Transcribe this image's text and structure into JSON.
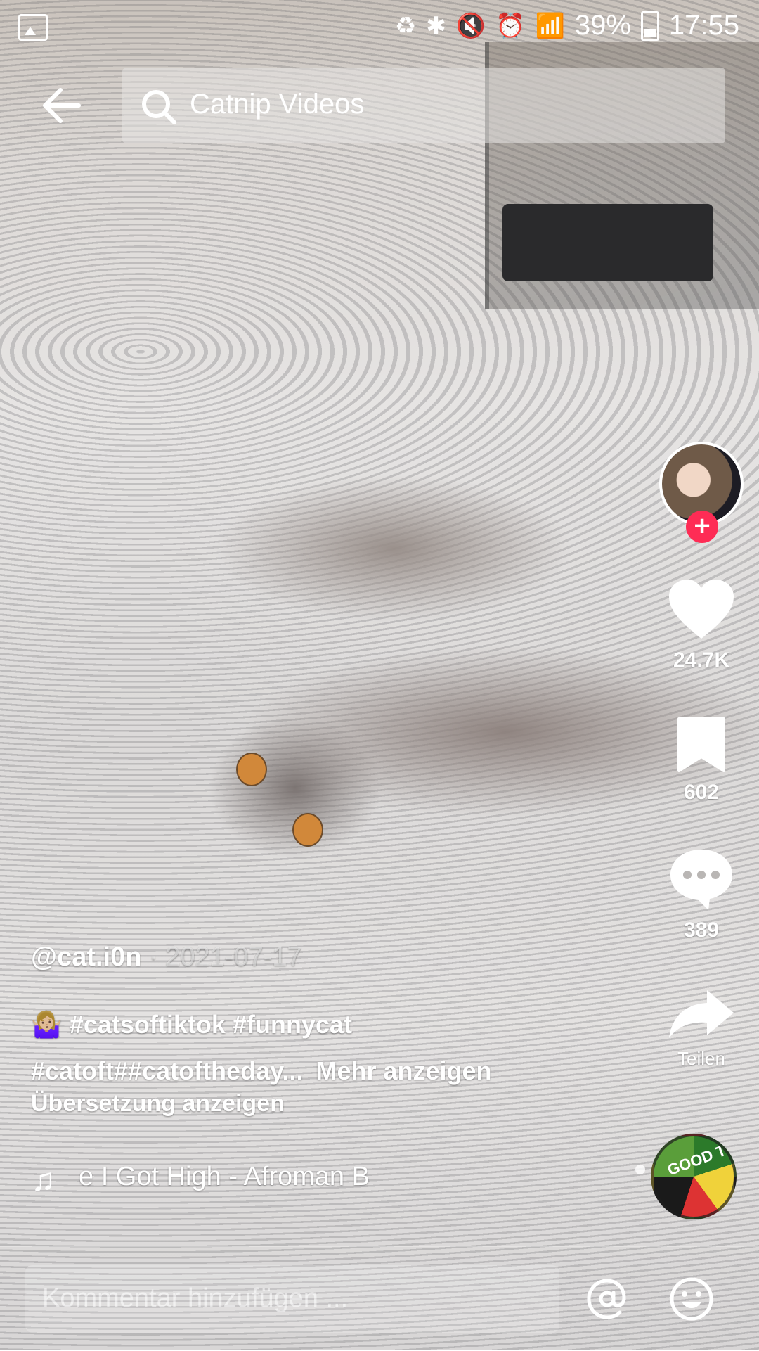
{
  "status_bar": {
    "battery_percent": "39%",
    "time": "17:55",
    "icons": [
      "gallery-icon",
      "battery-saver-icon",
      "bluetooth-icon",
      "mute-icon",
      "alarm-icon",
      "wifi-icon",
      "signal-icon",
      "battery-icon"
    ]
  },
  "top_bar": {
    "back_icon": "arrow-left-icon",
    "search_text": "Catnip Videos"
  },
  "right_rail": {
    "like_count": "24.7K",
    "bookmark_count": "602",
    "comment_count": "389",
    "share_label": "Teilen",
    "follow_label": "+"
  },
  "caption": {
    "author": "@cat.i0n",
    "separator": " · ",
    "date": "2021-07-17",
    "emoji": "🤷🏼‍♀️",
    "hashtags_line1": " #catsoftiktok #funnycat",
    "hashtags_line2": "#catoft##catoftheday...",
    "more_label": "Mehr anzeigen",
    "translate_label": "Übersetzung anzeigen"
  },
  "music": {
    "note": "♫",
    "text": "e I Got High - Afroman    B",
    "disc_text": "GOOD TI"
  },
  "comment_bar": {
    "placeholder": "Kommentar hinzufügen ..."
  },
  "colors": {
    "accent": "#fe2c55",
    "text": "#ffffff"
  }
}
